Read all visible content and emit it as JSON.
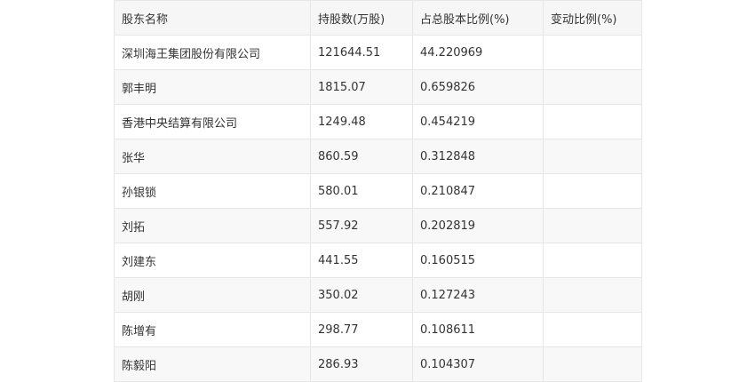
{
  "table": {
    "headers": [
      "股东名称",
      "持股数(万股)",
      "占总股本比例(%)",
      "变动比例(%)"
    ],
    "rows": [
      [
        "深圳海王集团股份有限公司",
        "121644.51",
        "44.220969",
        ""
      ],
      [
        "郭丰明",
        "1815.07",
        "0.659826",
        ""
      ],
      [
        "香港中央结算有限公司",
        "1249.48",
        "0.454219",
        ""
      ],
      [
        "张华",
        "860.59",
        "0.312848",
        ""
      ],
      [
        "孙银锁",
        "580.01",
        "0.210847",
        ""
      ],
      [
        "刘拓",
        "557.92",
        "0.202819",
        ""
      ],
      [
        "刘建东",
        "441.55",
        "0.160515",
        ""
      ],
      [
        "胡刚",
        "350.02",
        "0.127243",
        ""
      ],
      [
        "陈增有",
        "298.77",
        "0.108611",
        ""
      ],
      [
        "陈毅阳",
        "286.93",
        "0.104307",
        ""
      ]
    ]
  }
}
